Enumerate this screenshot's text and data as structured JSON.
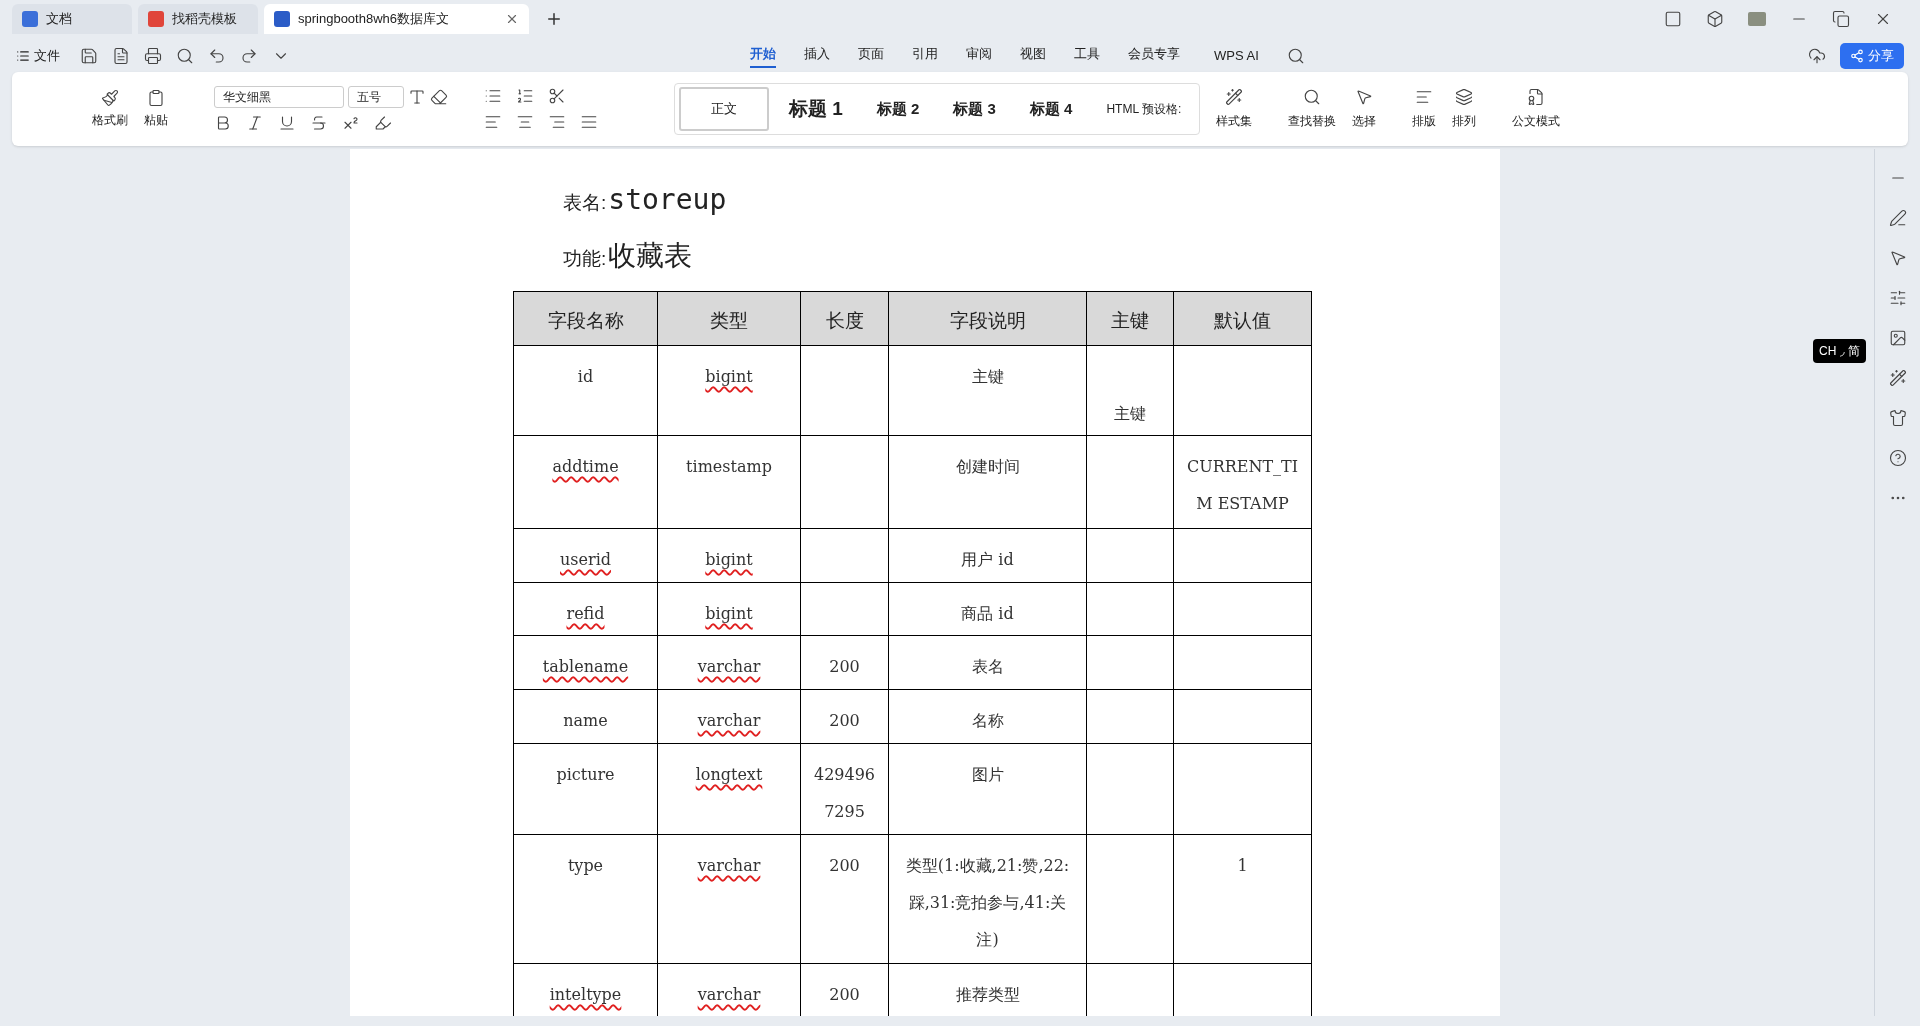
{
  "tabs": [
    {
      "label": "文档",
      "selected": false,
      "color": "#3b6fd9"
    },
    {
      "label": "找稻壳模板",
      "selected": false,
      "color": "#e0453a"
    },
    {
      "label": "springbooth8wh6数据库文",
      "selected": true,
      "color": "#2b5cc7"
    }
  ],
  "file_menu": "文件",
  "ribbon_tabs": [
    {
      "label": "开始",
      "selected": true
    },
    {
      "label": "插入",
      "selected": false
    },
    {
      "label": "页面",
      "selected": false
    },
    {
      "label": "引用",
      "selected": false
    },
    {
      "label": "审阅",
      "selected": false
    },
    {
      "label": "视图",
      "selected": false
    },
    {
      "label": "工具",
      "selected": false
    },
    {
      "label": "会员专享",
      "selected": false
    }
  ],
  "wps_ai": "WPS AI",
  "share_button": "分享",
  "ribbon": {
    "format_painter": "格式刷",
    "paste": "粘贴",
    "font": "华文细黑",
    "size": "五号",
    "styles": [
      {
        "label": "正文",
        "selected": true
      },
      {
        "label": "标题 1",
        "selected": false
      },
      {
        "label": "标题 2",
        "selected": false
      },
      {
        "label": "标题 3",
        "selected": false
      },
      {
        "label": "标题 4",
        "selected": false
      },
      {
        "label": "HTML 预设格:",
        "selected": false
      }
    ],
    "tools": [
      "样式集",
      "查找替换",
      "选择",
      "排版",
      "排列",
      "公文模式"
    ]
  },
  "document": {
    "table_name_label": "表名:",
    "table_name": "storeup",
    "function_label": "功能:",
    "function": "收藏表",
    "columns": [
      "字段名称",
      "类型",
      "长度",
      "字段说明",
      "主键",
      "默认值"
    ],
    "rows": [
      {
        "cells": [
          {
            "text": "id",
            "spell_error": false
          },
          {
            "text": "bigint",
            "spell_error": true
          },
          null,
          {
            "text": "主键",
            "spell_error": false
          },
          {
            "text": "主键",
            "spell_error": false
          },
          null
        ]
      },
      {
        "cells": [
          {
            "text": "addtime",
            "spell_error": true
          },
          {
            "text": "timestamp",
            "spell_error": false
          },
          null,
          {
            "text": "创建时间",
            "spell_error": false
          },
          null,
          {
            "text": "CURRENT_TIM ESTAMP",
            "spell_error": false
          }
        ]
      },
      {
        "cells": [
          {
            "text": "userid",
            "spell_error": true
          },
          {
            "text": "bigint",
            "spell_error": true
          },
          null,
          {
            "text": "用户 id",
            "spell_error": false
          },
          null,
          null
        ]
      },
      {
        "cells": [
          {
            "text": "refid",
            "spell_error": true
          },
          {
            "text": "bigint",
            "spell_error": true
          },
          null,
          {
            "text": "商品 id",
            "spell_error": false
          },
          null,
          null
        ]
      },
      {
        "cells": [
          {
            "text": "tablename",
            "spell_error": true
          },
          {
            "text": "varchar",
            "spell_error": true
          },
          {
            "text": "200",
            "spell_error": false
          },
          {
            "text": "表名",
            "spell_error": false
          },
          null,
          null
        ]
      },
      {
        "cells": [
          {
            "text": "name",
            "spell_error": false
          },
          {
            "text": "varchar",
            "spell_error": true
          },
          {
            "text": "200",
            "spell_error": false
          },
          {
            "text": "名称",
            "spell_error": false
          },
          null,
          null
        ]
      },
      {
        "cells": [
          {
            "text": "picture",
            "spell_error": false
          },
          {
            "text": "longtext",
            "spell_error": true
          },
          {
            "text": "4294967295",
            "spell_error": false
          },
          {
            "text": "图片",
            "spell_error": false
          },
          null,
          null
        ]
      },
      {
        "cells": [
          {
            "text": "type",
            "spell_error": false
          },
          {
            "text": "varchar",
            "spell_error": true
          },
          {
            "text": "200",
            "spell_error": false
          },
          {
            "text": "类型(1:收藏,21:赞,22:踩,31:竞拍参与,41:关注)",
            "spell_error": false
          },
          null,
          {
            "text": "1",
            "spell_error": false
          }
        ]
      },
      {
        "cells": [
          {
            "text": "inteltype",
            "spell_error": true
          },
          {
            "text": "varchar",
            "spell_error": true
          },
          {
            "text": "200",
            "spell_error": false
          },
          {
            "text": "推荐类型",
            "spell_error": false
          },
          null,
          null
        ]
      }
    ]
  },
  "ime_indicator": "CH ◞ 简"
}
